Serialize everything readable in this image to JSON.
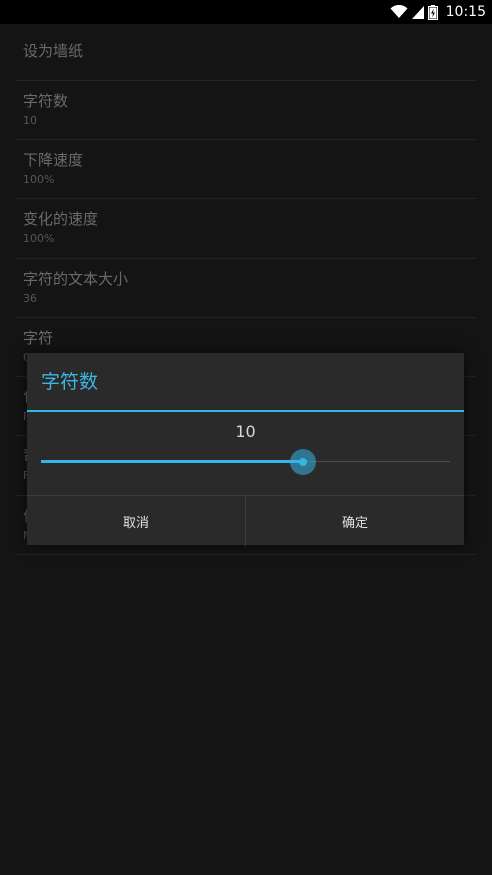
{
  "status_bar": {
    "time": "10:15",
    "icons": [
      "wifi-icon",
      "signal-icon",
      "battery-icon"
    ]
  },
  "settings": {
    "items": [
      {
        "title": "设为墙纸",
        "summary": ""
      },
      {
        "title": "字符数",
        "summary": "10"
      },
      {
        "title": "下降速度",
        "summary": "100%"
      },
      {
        "title": "变化的速度",
        "summary": "100%"
      },
      {
        "title": "字符的文本大小",
        "summary": "36"
      },
      {
        "title": "字符",
        "summary": "C"
      },
      {
        "title": "包",
        "summary": "F"
      },
      {
        "title": "司",
        "summary": "F"
      },
      {
        "title": "信",
        "summary": "M"
      }
    ]
  },
  "dialog": {
    "title": "字符数",
    "value": "10",
    "slider_fraction": 0.64,
    "cancel_label": "取消",
    "ok_label": "确定"
  },
  "colors": {
    "accent": "#33b5e5",
    "background": "#141414",
    "dialog_background": "#2a2a2a",
    "status_bar": "#000000"
  }
}
